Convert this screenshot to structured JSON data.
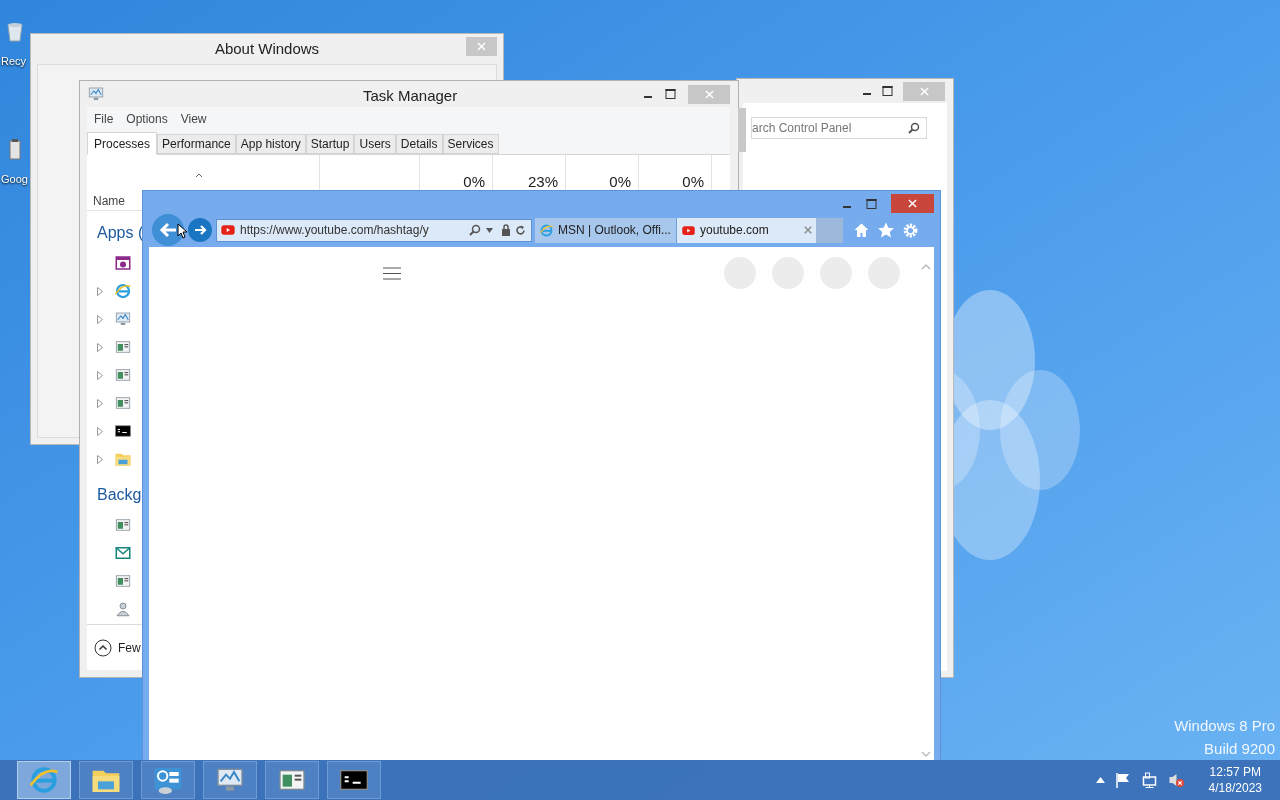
{
  "desktop_icons": [
    {
      "label": "Recy",
      "kind": "recycle"
    },
    {
      "label": "Goog",
      "kind": "app"
    }
  ],
  "about_window": {
    "title": "About Windows"
  },
  "control_panel": {
    "search_placeholder": "arch Control Panel"
  },
  "task_manager": {
    "title": "Task Manager",
    "menu": [
      "File",
      "Options",
      "View"
    ],
    "tabs": [
      {
        "label": "Processes",
        "selected": true
      },
      {
        "label": "Performance",
        "selected": false
      },
      {
        "label": "App history",
        "selected": false
      },
      {
        "label": "Startup",
        "selected": false
      },
      {
        "label": "Users",
        "selected": false
      },
      {
        "label": "Details",
        "selected": false
      },
      {
        "label": "Services",
        "selected": false
      }
    ],
    "column_readings": [
      "0%",
      "23%",
      "0%",
      "0%"
    ],
    "name_column": "Name",
    "groups": [
      {
        "label": "Apps (",
        "rows": [
          {
            "kind": "camera",
            "expandable": false
          },
          {
            "kind": "ie",
            "expandable": true
          },
          {
            "kind": "monitor",
            "expandable": true
          },
          {
            "kind": "window",
            "expandable": true
          },
          {
            "kind": "window",
            "expandable": true
          },
          {
            "kind": "window",
            "expandable": true
          },
          {
            "kind": "console",
            "expandable": true
          },
          {
            "kind": "folder",
            "expandable": true
          }
        ]
      },
      {
        "label": "Backg",
        "rows": [
          {
            "kind": "window",
            "expandable": false
          },
          {
            "kind": "mail",
            "expandable": false
          },
          {
            "kind": "window",
            "expandable": false
          },
          {
            "kind": "user",
            "expandable": false
          }
        ]
      }
    ],
    "fewer_details": "Few"
  },
  "browser": {
    "address": "https://www.youtube.com/hashtag/y",
    "tabs": [
      {
        "label": "MSN | Outlook, Offi...",
        "kind": "ie",
        "selected": false
      },
      {
        "label": "youtube.com",
        "kind": "youtube",
        "selected": true
      }
    ]
  },
  "watermark": [
    "Windows 8 Pro",
    "Build 9200"
  ],
  "taskbar": {
    "items": [
      {
        "kind": "ie",
        "selected": true
      },
      {
        "kind": "folder",
        "selected": false
      },
      {
        "kind": "control-panel",
        "selected": false
      },
      {
        "kind": "monitor",
        "selected": false
      },
      {
        "kind": "window",
        "selected": false
      },
      {
        "kind": "console",
        "selected": false
      }
    ],
    "time": "12:57 PM",
    "date": "4/18/2023"
  }
}
